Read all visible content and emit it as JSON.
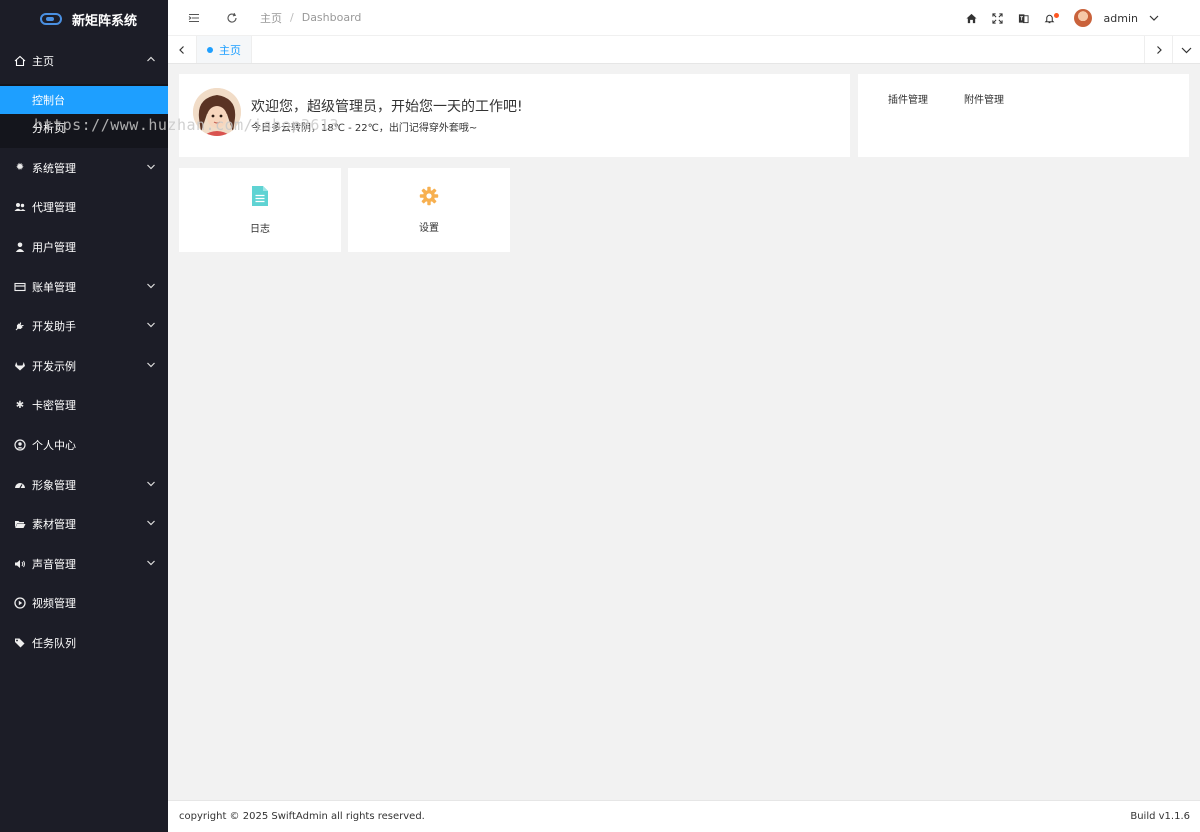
{
  "app": {
    "title": "新矩阵系统"
  },
  "sidebar": {
    "items": [
      {
        "label": "主页",
        "icon": "home-icon",
        "expanded": true,
        "children": [
          {
            "label": "控制台",
            "active": true
          },
          {
            "label": "分析页",
            "active": false
          }
        ]
      },
      {
        "label": "系统管理",
        "icon": "gear-icon",
        "has_children": true
      },
      {
        "label": "代理管理",
        "icon": "users-icon",
        "has_children": false
      },
      {
        "label": "用户管理",
        "icon": "user-icon",
        "has_children": false
      },
      {
        "label": "账单管理",
        "icon": "credit-card-icon",
        "has_children": true
      },
      {
        "label": "开发助手",
        "icon": "plug-icon",
        "has_children": true
      },
      {
        "label": "开发示例",
        "icon": "gitlab-icon",
        "has_children": true
      },
      {
        "label": "卡密管理",
        "icon": "asterisk-icon",
        "has_children": false
      },
      {
        "label": "个人中心",
        "icon": "user-circle-icon",
        "has_children": false
      },
      {
        "label": "形象管理",
        "icon": "dashboard-icon",
        "has_children": true
      },
      {
        "label": "素材管理",
        "icon": "folder-open-icon",
        "has_children": true
      },
      {
        "label": "声音管理",
        "icon": "volume-icon",
        "has_children": true
      },
      {
        "label": "视频管理",
        "icon": "play-circle-icon",
        "has_children": false
      },
      {
        "label": "任务队列",
        "icon": "tags-icon",
        "has_children": false
      }
    ]
  },
  "header": {
    "breadcrumb": [
      "主页",
      "Dashboard"
    ],
    "user": "admin"
  },
  "tabs": [
    {
      "label": "主页",
      "active": true
    }
  ],
  "welcome": {
    "greeting": "欢迎您，超级管理员，开始您一天的工作吧!",
    "weather": "今日多云转阴，18℃ - 22℃，出门记得穿外套哦~"
  },
  "plugin_links": [
    "插件管理",
    "附件管理"
  ],
  "quick_cards": [
    {
      "label": "日志",
      "icon": "file-icon",
      "color": "#5fd3d3"
    },
    {
      "label": "设置",
      "icon": "gear-icon",
      "color": "#f7b050"
    }
  ],
  "footer": {
    "copyright": "copyright © 2025 SwiftAdmin all rights reserved.",
    "build": "Build v1.1.6"
  },
  "watermark": "https://www.huzhan.com/ishop3613",
  "colors": {
    "sidebar_bg": "#1c1d27",
    "accent": "#1e9fff",
    "notify_dot": "#ff5722"
  }
}
